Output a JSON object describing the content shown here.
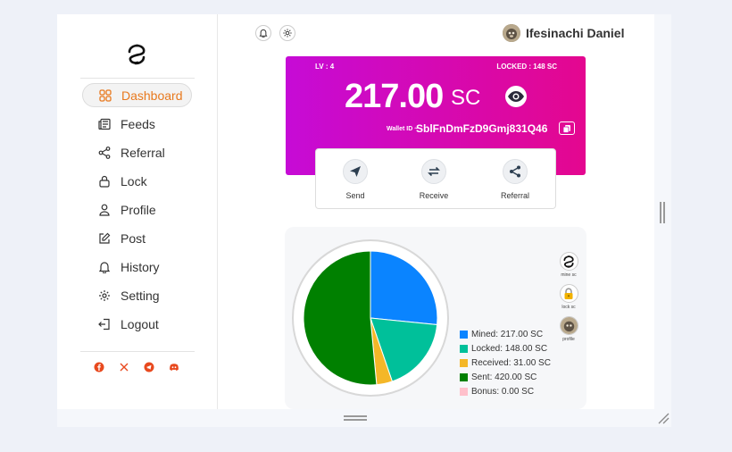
{
  "sidebar": {
    "items": [
      {
        "label": "Dashboard",
        "icon": "grid-icon",
        "active": true
      },
      {
        "label": "Feeds",
        "icon": "newspaper-icon"
      },
      {
        "label": "Referral",
        "icon": "share-icon"
      },
      {
        "label": "Lock",
        "icon": "lock-icon"
      },
      {
        "label": "Profile",
        "icon": "user-icon"
      },
      {
        "label": "Post",
        "icon": "edit-icon"
      },
      {
        "label": "History",
        "icon": "bell-icon"
      },
      {
        "label": "Setting",
        "icon": "gear-icon"
      },
      {
        "label": "Logout",
        "icon": "logout-icon"
      }
    ],
    "social": [
      "facebook-icon",
      "x-icon",
      "telegram-icon",
      "discord-icon"
    ],
    "accent": "#e8791e"
  },
  "header": {
    "user_name": "Ifesinachi Daniel"
  },
  "wallet": {
    "level": "LV : 4",
    "locked": "LOCKED : 148 SC",
    "balance": "217.00",
    "unit": "SC",
    "wallet_label": "Wallet ID ~",
    "wallet_id": "SblFnDmFzD9Gmj831Q46",
    "gradient": [
      "#c60bd6",
      "#e4078f"
    ]
  },
  "actions": [
    {
      "label": "Send",
      "icon": "send-icon"
    },
    {
      "label": "Receive",
      "icon": "swap-icon"
    },
    {
      "label": "Referral",
      "icon": "share-icon"
    }
  ],
  "side_icons": [
    {
      "label": "mine sc",
      "icon": "logo-icon"
    },
    {
      "label": "lock sc",
      "icon": "padlock-icon"
    },
    {
      "label": "profile",
      "icon": "avatar-icon"
    }
  ],
  "chart_data": {
    "type": "pie",
    "categories": [
      "Mined",
      "Locked",
      "Received",
      "Sent",
      "Bonus"
    ],
    "values": [
      217.0,
      148.0,
      31.0,
      420.0,
      0.0
    ],
    "colors": [
      "#0a84ff",
      "#00c09a",
      "#f4b728",
      "#008000",
      "#ffc0cb"
    ],
    "legend": [
      "Mined: 217.00 SC",
      "Locked: 148.00 SC",
      "Received: 31.00 SC",
      "Sent: 420.00 SC",
      "Bonus: 0.00 SC"
    ],
    "legend_position": "bottom-right"
  }
}
